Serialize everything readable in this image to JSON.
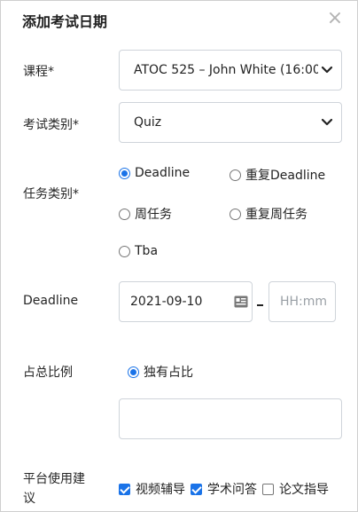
{
  "dialog": {
    "title": "添加考试日期",
    "close_icon": "×"
  },
  "course": {
    "label": "课程*",
    "selected": "ATOC 525 – John White (16:00"
  },
  "exam_type": {
    "label": "考试类别*",
    "selected": "Quiz"
  },
  "task_type": {
    "label": "任务类别*",
    "options": [
      {
        "label": "Deadline",
        "checked": true
      },
      {
        "label": "重复Deadline",
        "checked": false
      },
      {
        "label": "周任务",
        "checked": false
      },
      {
        "label": "重复周任务",
        "checked": false
      },
      {
        "label": "Tba",
        "checked": false
      }
    ]
  },
  "deadline": {
    "label": "Deadline",
    "date_value": "2021-09-10",
    "time_placeholder": "HH:mm",
    "separator": "–"
  },
  "weight": {
    "label": "占总比例",
    "option_label": "独有占比",
    "option_checked": true,
    "value": ""
  },
  "platform": {
    "label": "平台使用建议",
    "options": [
      {
        "label": "视频辅导",
        "checked": true
      },
      {
        "label": "学术问答",
        "checked": true
      },
      {
        "label": "论文指导",
        "checked": false
      }
    ]
  },
  "colors": {
    "accent": "#1a73e8",
    "border": "#cfd4da",
    "placeholder": "#9aa0a6"
  }
}
